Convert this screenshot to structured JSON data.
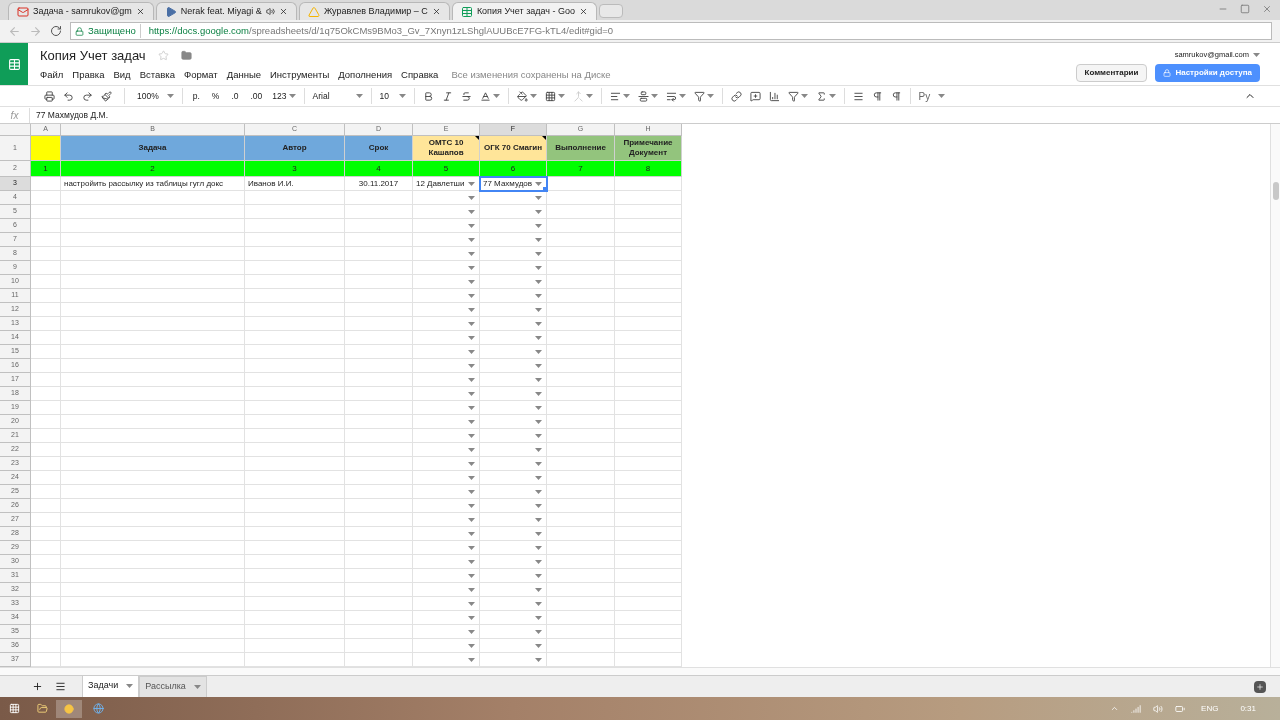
{
  "browser": {
    "tabs": [
      {
        "title": "Задача - samrukov@gm",
        "kind": "mail",
        "audio": false,
        "selected": false
      },
      {
        "title": "Nerak feat. Miyagi &",
        "kind": "video",
        "audio": true,
        "selected": false
      },
      {
        "title": "Журавлев Владимир – С",
        "kind": "drive",
        "audio": false,
        "selected": false
      },
      {
        "title": "Копия Учет задач - Goo",
        "kind": "sheets",
        "audio": false,
        "selected": true
      }
    ]
  },
  "address": {
    "security": "Защищено",
    "host": "https://docs.google.com",
    "path": "/spreadsheets/d/1q75OkCMs9BMo3_Gv_7Xnyn1zLShglAUUBcE7FG-kTL4/edit#gid=0"
  },
  "doc": {
    "title": "Копия Учет задач",
    "menu": [
      "Файл",
      "Правка",
      "Вид",
      "Вставка",
      "Формат",
      "Данные",
      "Инструменты",
      "Дополнения",
      "Справка"
    ],
    "save_status": "Все изменения сохранены на Диске",
    "account": "samrukov@gmail.com",
    "comments_button": "Комментарии",
    "share_button": "Настройки доступа"
  },
  "toolbar": {
    "zoom": "100%",
    "currency": "р.",
    "percent": "%",
    "decimal_less": ".0",
    "decimal_more": ".00",
    "number_format": "123",
    "font": "Arial",
    "font_size": "10",
    "input_tools": "Ру"
  },
  "formula_bar": {
    "label": "fx",
    "value": "77 Махмудов Д.М."
  },
  "sheet": {
    "columns": [
      {
        "letter": "A",
        "selected": false,
        "dropdown": false
      },
      {
        "letter": "B",
        "selected": false,
        "dropdown": false
      },
      {
        "letter": "C",
        "selected": false,
        "dropdown": false
      },
      {
        "letter": "D",
        "selected": false,
        "dropdown": false
      },
      {
        "letter": "E",
        "selected": false,
        "dropdown": true
      },
      {
        "letter": "F",
        "selected": true,
        "dropdown": true
      },
      {
        "letter": "G",
        "selected": false,
        "dropdown": false
      },
      {
        "letter": "H",
        "selected": false,
        "dropdown": false
      }
    ],
    "rows": [
      {
        "number": "1",
        "selected": false,
        "cells": [
          {
            "color": "#ffff00",
            "note": false
          },
          {
            "text": "Задача",
            "color": "#6fa8dc",
            "note": false
          },
          {
            "text": "Автор",
            "color": "#6fa8dc",
            "note": false
          },
          {
            "text": "Срок",
            "color": "#6fa8dc",
            "note": false
          },
          {
            "text": "ОМТС 10 Кашапов",
            "color": "#ffe599",
            "note": true
          },
          {
            "text": "ОГК 70 Смагин",
            "color": "#ffe599",
            "note": true
          },
          {
            "text": "Выполнение",
            "color": "#93c47d",
            "note": false
          },
          {
            "text": "Примечание Документ",
            "color": "#93c47d",
            "note": false
          }
        ]
      },
      {
        "number": "2",
        "selected": false,
        "cells": [
          {
            "text": "1",
            "color": "#00ff00"
          },
          {
            "text": "2",
            "color": "#00ff00"
          },
          {
            "text": "3",
            "color": "#00ff00"
          },
          {
            "text": "4",
            "color": "#00ff00"
          },
          {
            "text": "5",
            "color": "#00ff00"
          },
          {
            "text": "6",
            "color": "#00ff00"
          },
          {
            "text": "7",
            "color": "#00ff00"
          },
          {
            "text": "8",
            "color": "#00ff00"
          }
        ]
      },
      {
        "number": "3",
        "selected": true,
        "cells": [
          {
            "selected": false
          },
          {
            "text": "настройить рассылку из таблицы гугл докс",
            "selected": false
          },
          {
            "text": "Иванов И.И.",
            "selected": false
          },
          {
            "text": "30.11.2017",
            "selected": false
          },
          {
            "text": "12 Давлетши",
            "selected": false
          },
          {
            "text": "77 Махмудов",
            "selected": true
          },
          {
            "selected": false
          },
          {
            "selected": false
          }
        ]
      },
      {
        "number": "4"
      },
      {
        "number": "5"
      },
      {
        "number": "6"
      },
      {
        "number": "7"
      },
      {
        "number": "8"
      },
      {
        "number": "9"
      },
      {
        "number": "10"
      },
      {
        "number": "11"
      },
      {
        "number": "12"
      },
      {
        "number": "13"
      },
      {
        "number": "14"
      },
      {
        "number": "15"
      },
      {
        "number": "16"
      },
      {
        "number": "17"
      },
      {
        "number": "18"
      },
      {
        "number": "19"
      },
      {
        "number": "20"
      },
      {
        "number": "21"
      },
      {
        "number": "22"
      },
      {
        "number": "23"
      },
      {
        "number": "24"
      },
      {
        "number": "25"
      },
      {
        "number": "26"
      },
      {
        "number": "27"
      },
      {
        "number": "28"
      },
      {
        "number": "29"
      },
      {
        "number": "30"
      },
      {
        "number": "31"
      },
      {
        "number": "32"
      },
      {
        "number": "33"
      },
      {
        "number": "34"
      },
      {
        "number": "35"
      },
      {
        "number": "36"
      },
      {
        "number": "37"
      }
    ]
  },
  "sheet_tabs": [
    {
      "label": "Задачи",
      "selected": true
    },
    {
      "label": "Рассылка",
      "selected": false
    }
  ],
  "taskbar": {
    "language": "ENG",
    "time": "0:31"
  }
}
